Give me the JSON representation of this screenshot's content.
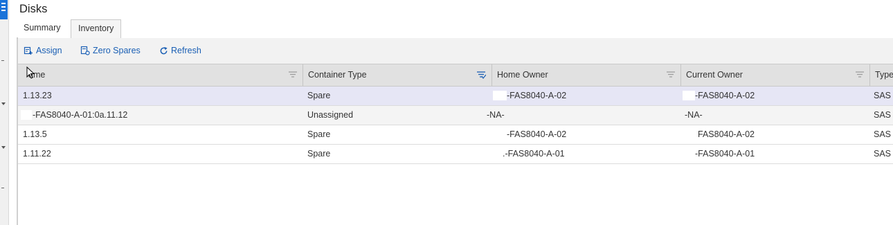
{
  "page": {
    "title": "Disks"
  },
  "tabs": [
    {
      "label": "Summary",
      "active": false
    },
    {
      "label": "Inventory",
      "active": true
    }
  ],
  "toolbar": {
    "assign": "Assign",
    "zero_spares": "Zero Spares",
    "refresh": "Refresh"
  },
  "columns": [
    {
      "label": "Name",
      "shown_label": "ame"
    },
    {
      "label": "Container Type",
      "filter_active": true
    },
    {
      "label": "Home Owner"
    },
    {
      "label": "Current Owner"
    },
    {
      "label": "Type"
    }
  ],
  "rows": [
    {
      "name": "1.13.23",
      "container_type": "Spare",
      "home_owner": "-FAS8040-A-02",
      "current_owner": "-FAS8040-A-02",
      "type": "SAS",
      "selected": true
    },
    {
      "name": "-FAS8040-A-01:0a.11.12",
      "container_type": "Unassigned",
      "home_owner": "-NA-",
      "current_owner": "-NA-",
      "type": "SAS"
    },
    {
      "name": "1.13.5",
      "container_type": "Spare",
      "home_owner": "-FAS8040-A-02",
      "current_owner": "FAS8040-A-02",
      "type": "SAS"
    },
    {
      "name": "1.11.22",
      "container_type": "Spare",
      "home_owner": ".-FAS8040-A-01",
      "current_owner": "-FAS8040-A-01",
      "type": "SAS"
    }
  ],
  "colors": {
    "accent": "#1a5fb4",
    "rail_menu": "#1a73d9",
    "selected_row": "#e6e6f5",
    "header_bg": "#e1e1e1"
  }
}
